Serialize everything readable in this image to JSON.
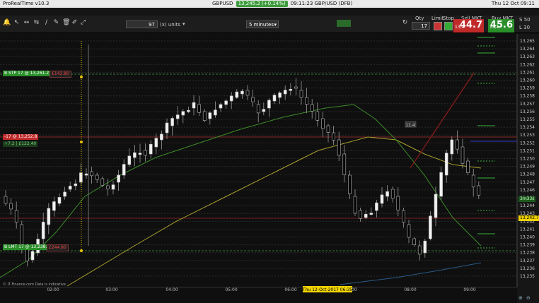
{
  "menubar": {
    "app": "ProRealTime v10.3",
    "instrument": "GBPUSD",
    "price_pill": "13,245.2 (+0.14%)",
    "time_info": "09:11:23 GBP/USD (DFB)",
    "clock": "Thu 12 Oct  09:11"
  },
  "toolbar": {
    "units_value": "97",
    "units_label": "(x) units",
    "timeframe": "5 minutes",
    "qty_label": "Qty",
    "qty_value": "17",
    "limit_label": "Limit",
    "stop_label": "Stop",
    "sell_label": "Sell MKT",
    "buy_label": "Buy MKT",
    "sell_small": "13,2",
    "sell_big": "44.7",
    "buy_small": "13,2",
    "buy_big": "45.6",
    "s_label": "S",
    "s_value": "50",
    "l_label": "L",
    "l_value": "30"
  },
  "orders": {
    "bstp": "B STP 17 @ 13,261.2",
    "bstp_pnl": "£142.80",
    "position": "-17 @ 13,252.8",
    "position_pnl": "+7.2 | £122.40",
    "blmt": "B LMT 17 @ 13,238.4",
    "blmt_pnl": "£244.80"
  },
  "axis": {
    "price_labels": [
      "13,265",
      "13,264",
      "13,263",
      "13,262",
      "13,261",
      "13,260",
      "13,259",
      "13,258",
      "13,257",
      "13,256",
      "13,255",
      "13,254",
      "13,253",
      "13,252",
      "13,251",
      "13,250",
      "13,249",
      "13,248",
      "13,247",
      "13,246",
      "13,245",
      "13,244",
      "13,243",
      "13,242",
      "13,241",
      "13,240",
      "13,239",
      "13,238",
      "13,237",
      "13,236",
      "13,235"
    ],
    "current_price": "13,242.7",
    "countdown": "3m33s",
    "time_labels": [
      "02:00",
      "03:00",
      "04:00",
      "05:00",
      "06:00",
      "08:00",
      "09:00"
    ],
    "cursor_time": "Thu 12-Oct-2017 06:35",
    "cursor_tail": "00",
    "mid_label": "11.4",
    "footer": "© IT-Finance.com  Data is indicative"
  },
  "colors": {
    "sell": "#c12a2a",
    "buy": "#2a8f2a",
    "accent_yellow": "#f2d400",
    "ma_slow": "#a9a12c",
    "ma_fast": "#3c8c2a"
  }
}
